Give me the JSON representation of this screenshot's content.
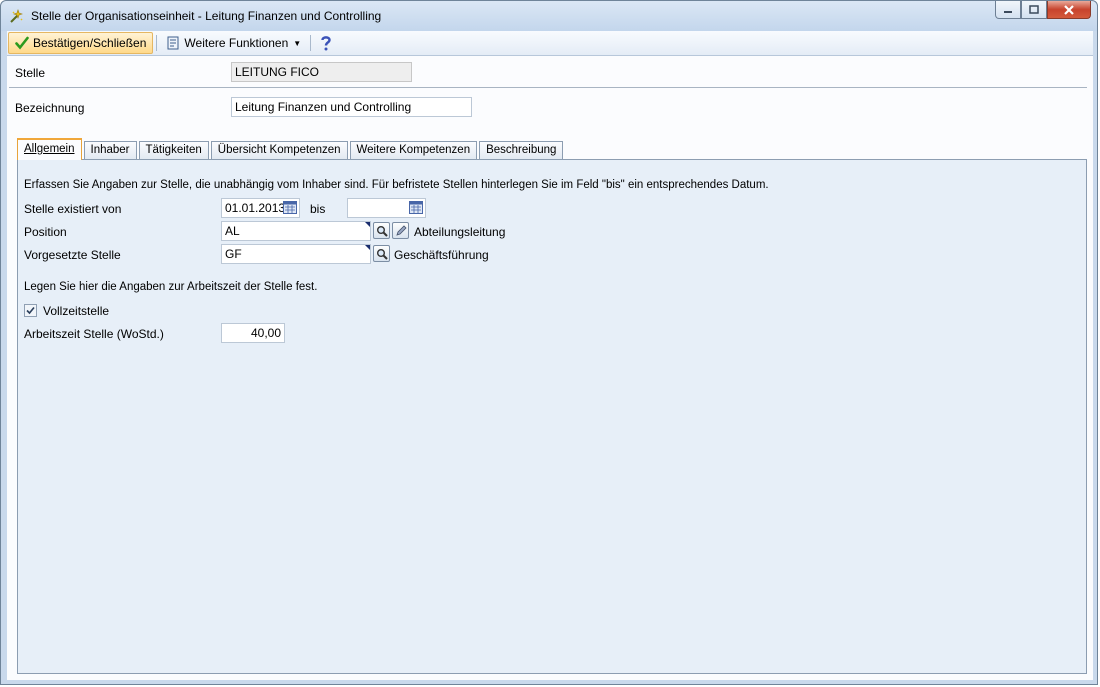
{
  "window": {
    "title": "Stelle der Organisationseinheit - Leitung Finanzen und Controlling"
  },
  "toolbar": {
    "confirm_label": "Bestätigen/Schließen",
    "more_label": "Weitere Funktionen",
    "help_icon": "help-icon"
  },
  "header": {
    "stelle_label": "Stelle",
    "stelle_value": "LEITUNG FICO",
    "bezeichnung_label": "Bezeichnung",
    "bezeichnung_value": "Leitung Finanzen und Controlling"
  },
  "tabs": [
    {
      "label": "Allgemein",
      "active": true
    },
    {
      "label": "Inhaber"
    },
    {
      "label": "Tätigkeiten"
    },
    {
      "label": "Übersicht Kompetenzen"
    },
    {
      "label": "Weitere Kompetenzen"
    },
    {
      "label": "Beschreibung"
    }
  ],
  "general": {
    "intro_text": "Erfassen Sie Angaben zur Stelle, die unabhängig vom Inhaber sind. Für befristete Stellen hinterlegen Sie im Feld \"bis\" ein entsprechendes Datum.",
    "exists_from_label": "Stelle existiert von",
    "exists_from_value": "01.01.2013",
    "bis_label": "bis",
    "bis_value": "",
    "position_label": "Position",
    "position_value": "AL",
    "position_desc": "Abteilungsleitung",
    "superior_label": "Vorgesetzte Stelle",
    "superior_value": "GF",
    "superior_desc": "Geschäftsführung",
    "worktime_intro": "Legen Sie hier die Angaben zur Arbeitszeit der Stelle fest.",
    "fulltime_label": "Vollzeitstelle",
    "fulltime_checked": true,
    "hours_label": "Arbeitszeit Stelle (WoStd.)",
    "hours_value": "40,00"
  },
  "colors": {
    "accent_tab": "#f0a73a",
    "panel_bg": "#e7eff8",
    "primary_button_bg": "#ffd98a"
  }
}
